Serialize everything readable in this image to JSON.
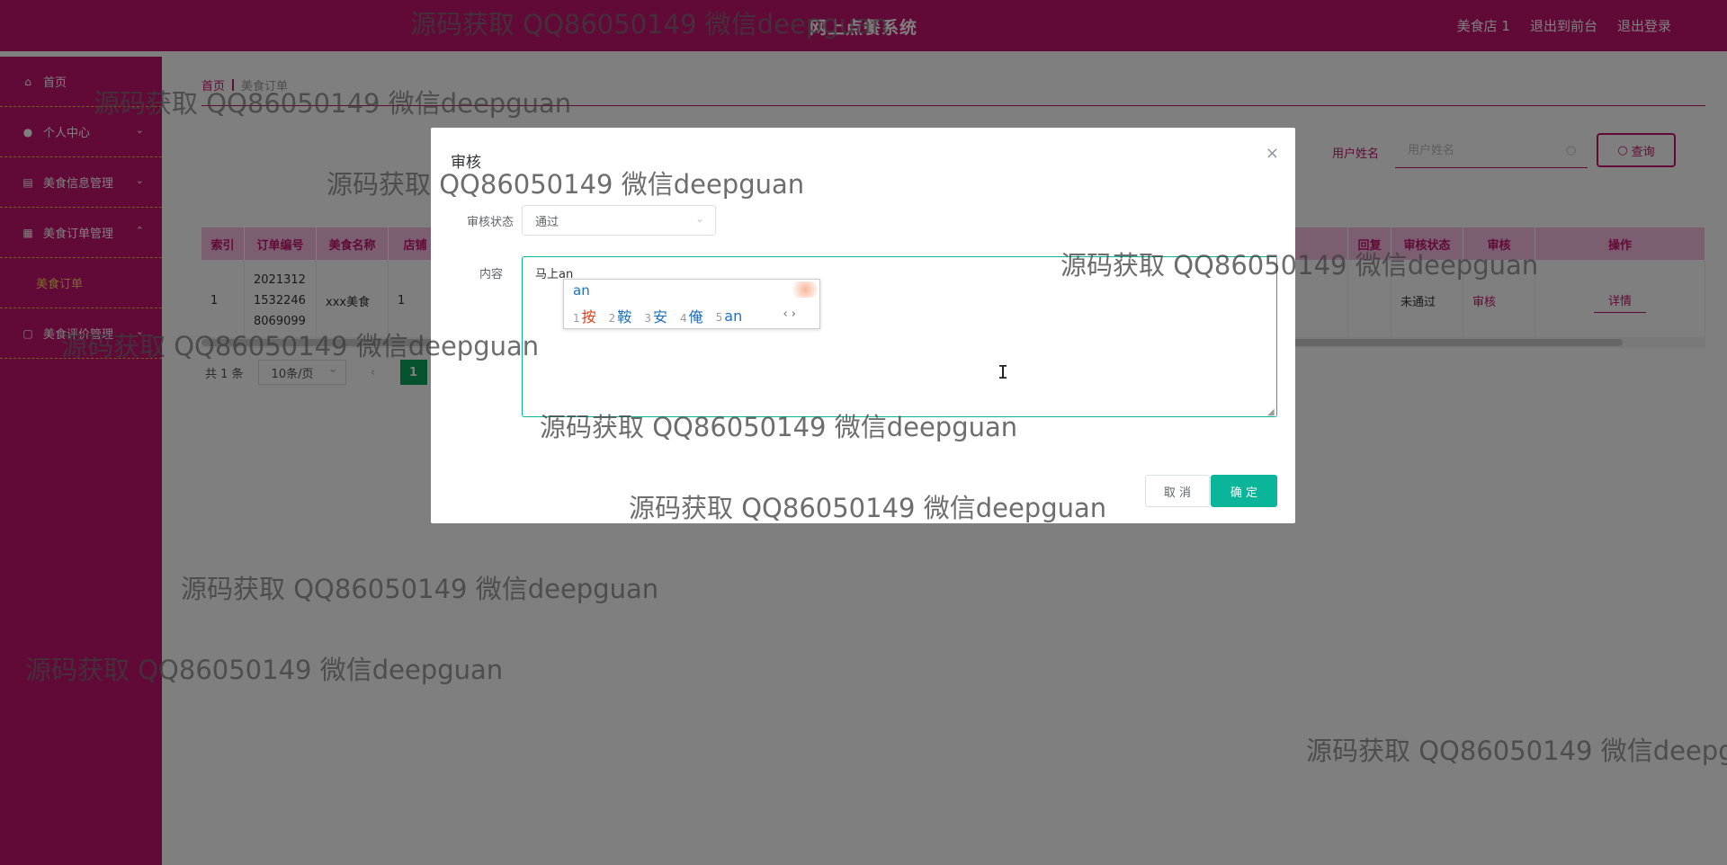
{
  "header": {
    "title": "网上点餐系统",
    "links": [
      "美食店 1",
      "退出到前台",
      "退出登录"
    ]
  },
  "sidebar": {
    "items": [
      {
        "label": "首页",
        "icon": "home-icon"
      },
      {
        "label": "个人中心",
        "icon": "user-icon",
        "expandable": true
      },
      {
        "label": "美食信息管理",
        "icon": "file-icon",
        "expandable": true
      },
      {
        "label": "美食订单管理",
        "icon": "list-icon",
        "expanded": true
      },
      {
        "label": "美食订单",
        "sub": true
      },
      {
        "label": "美食评价管理",
        "icon": "comment-icon",
        "expandable": true
      }
    ]
  },
  "breadcrumb": {
    "home": "首页",
    "current": "美食订单"
  },
  "search": {
    "label": "用户姓名",
    "placeholder": "用户姓名",
    "button": "查询"
  },
  "table": {
    "headers": [
      "索引",
      "订单编号",
      "美食名称",
      "店铺",
      "回复",
      "审核状态",
      "审核",
      "操作"
    ],
    "rows": [
      {
        "index": "1",
        "order_no": "2021312\n1532246\n8069099",
        "food": "xxx美食",
        "shop": "1",
        "status": "未通过",
        "review": "审核",
        "action": "详情"
      }
    ]
  },
  "pagination": {
    "total": "共 1 条",
    "page_size": "10条/页",
    "current": "1"
  },
  "dialog": {
    "title": "审核",
    "status_label": "审核状态",
    "status_value": "通过",
    "content_label": "内容",
    "content_value": "马上an",
    "cancel": "取 消",
    "confirm": "确 定"
  },
  "ime": {
    "pinyin": "an",
    "candidates": [
      {
        "n": "1",
        "text": "按"
      },
      {
        "n": "2",
        "text": "鞍"
      },
      {
        "n": "3",
        "text": "安"
      },
      {
        "n": "4",
        "text": "俺"
      },
      {
        "n": "5",
        "text": "an"
      }
    ],
    "nav": "‹ ›"
  },
  "watermark": "源码获取 QQ86050149 微信deepguan",
  "colors": {
    "brand": "#c4146f",
    "accent": "#0bb59a",
    "highlight": "#f6d55c"
  }
}
